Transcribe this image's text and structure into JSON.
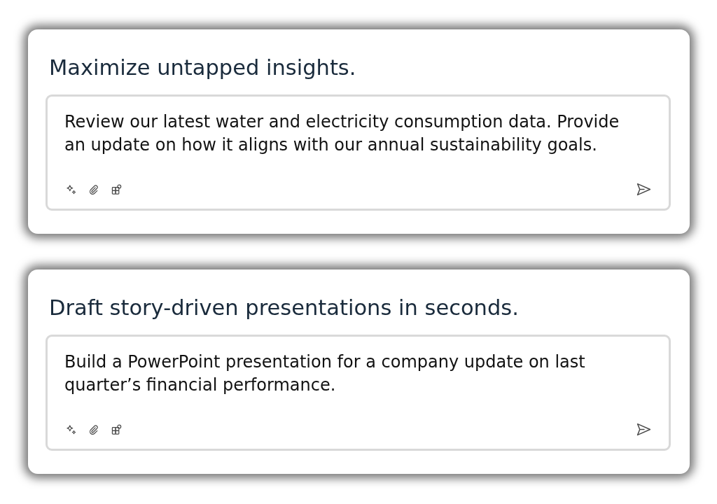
{
  "cards": [
    {
      "heading": "Maximize untapped insights.",
      "prompt": "Review our latest water and electricity consumption data. Provide an update on how it aligns with our annual sustainability goals."
    },
    {
      "heading": "Draft story-driven presentations in seconds.",
      "prompt": "Build a PowerPoint presentation for a company update on last quarter’s financial performance."
    }
  ]
}
